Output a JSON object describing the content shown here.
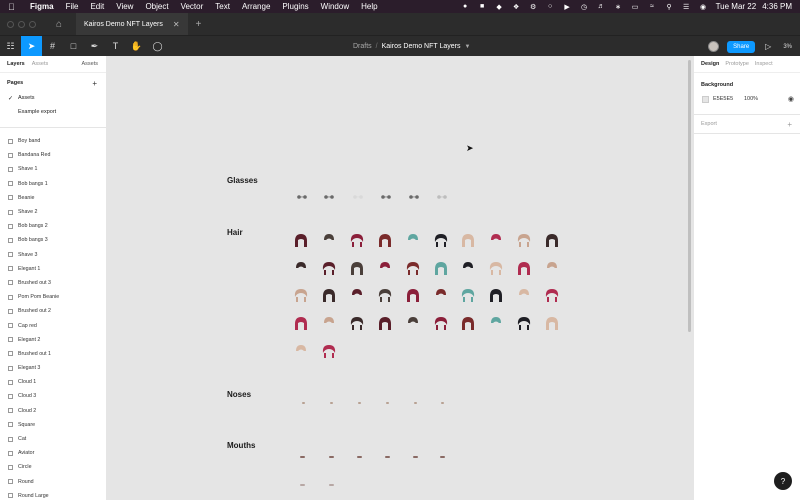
{
  "menubar": {
    "app": "Figma",
    "items": [
      "File",
      "Edit",
      "View",
      "Object",
      "Vector",
      "Text",
      "Arrange",
      "Plugins",
      "Window",
      "Help"
    ],
    "date": "Tue Mar 22",
    "time": "4:36 PM"
  },
  "tabbar": {
    "file_tab": "Kairos Demo NFT Layers",
    "close": "✕",
    "new_tab": "+"
  },
  "toolbar": {
    "breadcrumb": "Drafts",
    "separator": "/",
    "document": "Kairos Demo NFT Layers",
    "share_label": "Share",
    "zoom": "3%"
  },
  "left_panel": {
    "tab_layers": "Layers",
    "tab_assets": "Assets",
    "page_selector": "Assets",
    "pages_heading": "Pages",
    "pages": [
      {
        "label": "Assets",
        "selected": true
      },
      {
        "label": "Example export",
        "selected": false
      }
    ],
    "layers": [
      "Boy band",
      "Bandana Red",
      "Shave 1",
      "Bob bangs 1",
      "Beanie",
      "Shave 2",
      "Bob bangs 2",
      "Bob bangs 3",
      "Shave 3",
      "Elegant 1",
      "Brushed out 3",
      "Pom Pom Beanie",
      "Brushed out 2",
      "Cap red",
      "Elegant 2",
      "Brushed out 1",
      "Elegant 3",
      "Cloud 1",
      "Cloud 3",
      "Cloud 2",
      "Square",
      "Cat",
      "Aviator",
      "Circle",
      "Round",
      "Round Large"
    ]
  },
  "canvas": {
    "sections": {
      "glasses": "Glasses",
      "hair": "Hair",
      "noses": "Noses",
      "mouths": "Mouths"
    },
    "hair_colors": [
      "#5a1f2a",
      "#7a2b2b",
      "#d8b8a3",
      "#3a2a2a",
      "#8b1f3a",
      "#1f1f25",
      "#c8a48f",
      "#4a3f3a",
      "#5fa6a0",
      "#b02c50"
    ]
  },
  "right_panel": {
    "tab_design": "Design",
    "tab_prototype": "Prototype",
    "tab_inspect": "Inspect",
    "background_heading": "Background",
    "background_hex": "E5E5E5",
    "background_opacity": "100%",
    "export_label": "Export",
    "help": "?"
  }
}
